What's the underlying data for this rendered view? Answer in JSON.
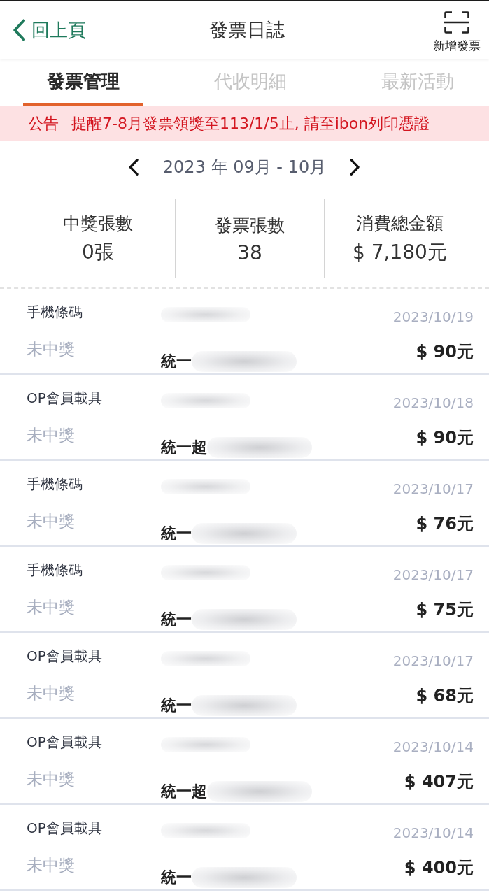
{
  "header": {
    "back_label": "回上頁",
    "title": "發票日誌",
    "action_label": "新增發票"
  },
  "tabs": [
    {
      "label": "發票管理",
      "selected": true
    },
    {
      "label": "代收明細",
      "selected": false
    },
    {
      "label": "最新活動",
      "selected": false
    }
  ],
  "announcement": {
    "tag": "公告",
    "message": "提醒7-8月發票領獎至113/1/5止, 請至ibon列印憑證"
  },
  "period": {
    "label": "2023 年 09月 - 10月"
  },
  "summary": [
    {
      "label": "中獎張數",
      "value": "0張"
    },
    {
      "label": "發票張數",
      "value": "38"
    },
    {
      "label": "消費總金額",
      "value": "$ 7,180元"
    }
  ],
  "invoices": [
    {
      "carrier": "手機條碼",
      "status": "未中獎",
      "store": "統一",
      "date": "2023/10/19",
      "amount": "$ 90元"
    },
    {
      "carrier": "OP會員載具",
      "status": "未中獎",
      "store": "統一超",
      "date": "2023/10/18",
      "amount": "$ 90元"
    },
    {
      "carrier": "手機條碼",
      "status": "未中獎",
      "store": "統一",
      "date": "2023/10/17",
      "amount": "$ 76元"
    },
    {
      "carrier": "手機條碼",
      "status": "未中獎",
      "store": "統一",
      "date": "2023/10/17",
      "amount": "$ 75元"
    },
    {
      "carrier": "OP會員載具",
      "status": "未中獎",
      "store": "統一",
      "date": "2023/10/17",
      "amount": "$ 68元"
    },
    {
      "carrier": "OP會員載具",
      "status": "未中獎",
      "store": "統一超",
      "date": "2023/10/14",
      "amount": "$ 407元"
    },
    {
      "carrier": "OP會員載具",
      "status": "未中獎",
      "store": "統一",
      "date": "2023/10/14",
      "amount": "$ 400元"
    }
  ]
}
